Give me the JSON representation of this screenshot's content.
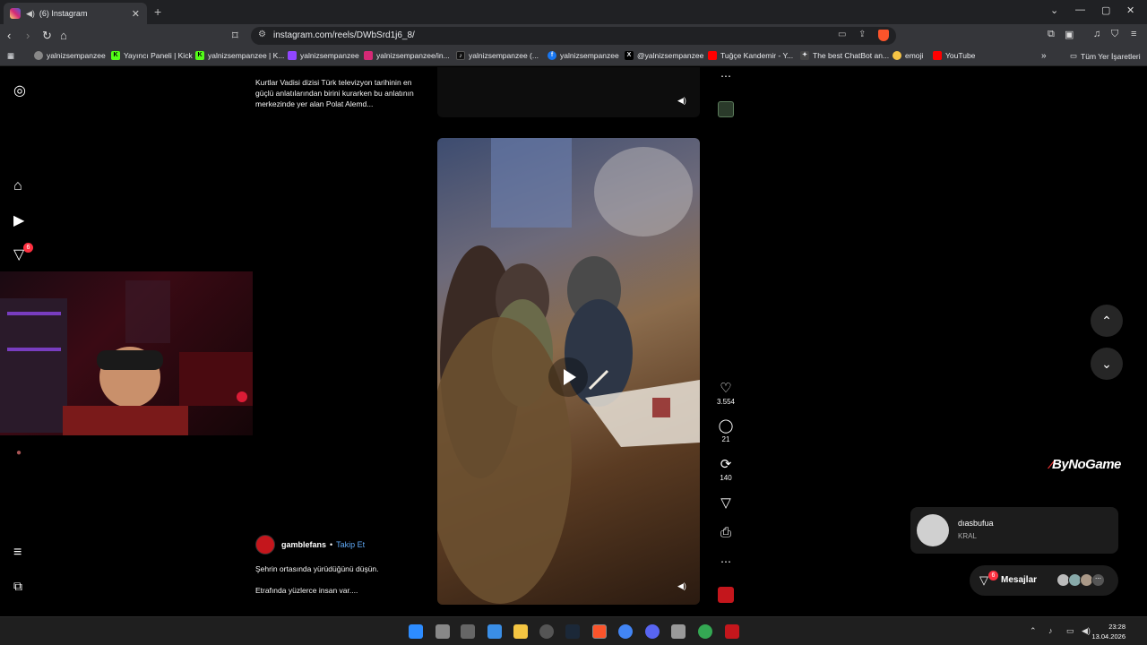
{
  "browser": {
    "tab_title": "(6) Instagram",
    "tab_close": "✕",
    "new_tab": "+",
    "url": "instagram.com/reels/DWbSrd1j6_8/",
    "window_controls": [
      "⌄",
      "—",
      "▢",
      "✕"
    ]
  },
  "bookmarks": [
    {
      "label": "yalnizsempanzee",
      "icon": "globe-icon"
    },
    {
      "label": "Yayıncı Paneli | Kick",
      "icon": "kick-icon"
    },
    {
      "label": "yalnizsempanzee | K...",
      "icon": "kick-icon"
    },
    {
      "label": "yalnizsempanzee",
      "icon": "twitch-icon"
    },
    {
      "label": "yalnizsempanzee/in...",
      "icon": "instagram-icon"
    },
    {
      "label": "yalnizsempanzee (...",
      "icon": "tiktok-icon"
    },
    {
      "label": "yalnizsempanzee",
      "icon": "facebook-icon"
    },
    {
      "label": "@yalnizsempanzee",
      "icon": "x-icon"
    },
    {
      "label": "Tuğçe Kandemir - Y...",
      "icon": "youtube-icon"
    },
    {
      "label": "The best ChatBot an...",
      "icon": "chatbot-icon"
    },
    {
      "label": "emoji",
      "icon": "emoji-icon"
    },
    {
      "label": "YouTube",
      "icon": "youtube-icon"
    }
  ],
  "bookmarks_more": "»",
  "bookmarks_folder": "Tüm Yer İşaretleri",
  "sidebar": {
    "notifications_badge": "6"
  },
  "post_top": {
    "caption": "Kurtlar Vadisi dizisi Türk televizyon tarihinin en güçlü anlatılarından birini kurarken bu anlatının merkezinde yer alan Polat Alemd..."
  },
  "post": {
    "username": "gamblefans",
    "separator": "•",
    "follow_label": "Takip Et",
    "caption_line1": "Şehrin ortasında yürüdüğünü düşün.",
    "caption_line2": "Etrafında yüzlerce insan var....",
    "likes": "3.554",
    "comments": "21",
    "reposts": "140"
  },
  "overlay": {
    "brand": "ByNoGame",
    "notif_name": "dıasbufua",
    "notif_sub": "KRAL",
    "messages_label": "Mesajlar",
    "messages_badge": "6"
  },
  "taskbar": {
    "time": "23:28",
    "date": "13.04.2026"
  },
  "colors": {
    "accent_follow": "#5fa8f5",
    "badge_red": "#ff3040",
    "brave_orange": "#fb542b"
  }
}
